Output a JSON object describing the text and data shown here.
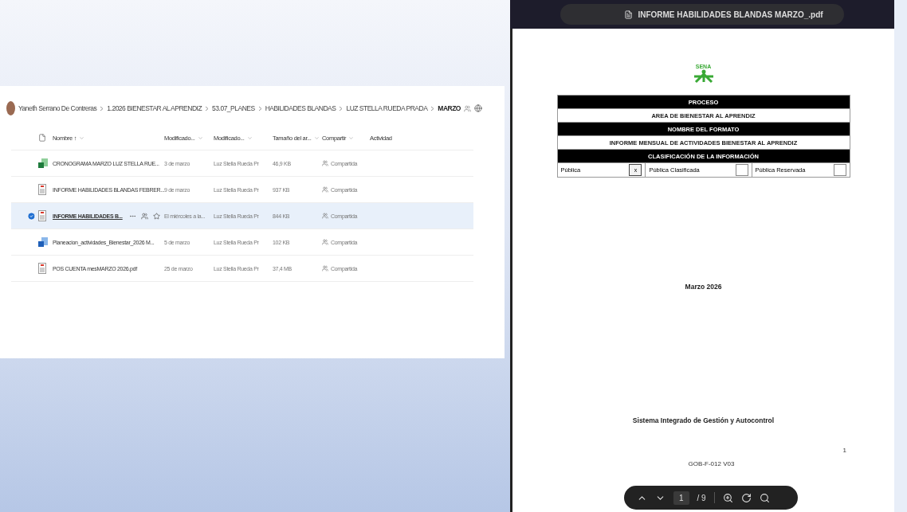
{
  "breadcrumb": {
    "owner": "Yaneth Serrano De Contreras",
    "items": [
      {
        "label": "1.2026 BIENESTAR AL APRENDIZ",
        "current": false
      },
      {
        "label": "53.07_PLANES",
        "current": false
      },
      {
        "label": "HABILIDADES BLANDAS",
        "current": false
      },
      {
        "label": "LUZ STELLA RUEDA PRADA",
        "current": false
      },
      {
        "label": "MARZO",
        "current": true
      }
    ]
  },
  "table": {
    "columns": [
      "Nombre ↑",
      "Modificado...",
      "Modificado...",
      "Tamaño del ar...",
      "Compartir",
      "Actividad"
    ],
    "rows": [
      {
        "kind": "excel",
        "name": "CRONOGRAMA MARZO LUZ STELLA RUE...",
        "modified": "3 de marzo",
        "modified_by": "Luz Stella Rueda Pr",
        "size": "46,9 KB",
        "sharing": "Compartida",
        "selected": false
      },
      {
        "kind": "pdf",
        "name": "INFORME HABILIDADES BLANDAS FEBRER...",
        "modified": "9 de marzo",
        "modified_by": "Luz Stella Rueda Pr",
        "size": "937 KB",
        "sharing": "Compartida",
        "selected": false
      },
      {
        "kind": "pdf",
        "name": "INFORME HABILIDADES B...",
        "modified": "El miércoles a la...",
        "modified_by": "Luz Stella Rueda Pr",
        "size": "844 KB",
        "sharing": "Compartida",
        "selected": true
      },
      {
        "kind": "word",
        "name": "Planeacion_actividades_Bienestar_2026 M...",
        "modified": "5 de marzo",
        "modified_by": "Luz Stella Rueda Pr",
        "size": "102 KB",
        "sharing": "Compartida",
        "selected": false
      },
      {
        "kind": "pdf",
        "name": "POS CUENTA mesMARZO 2026.pdf",
        "modified": "25 de marzo",
        "modified_by": "Luz Stella Rueda Pr",
        "size": "37,4 MB",
        "sharing": "Compartida",
        "selected": false
      }
    ]
  },
  "viewer": {
    "title": "INFORME HABILIDADES BLANDAS MARZO_.pdf",
    "page": {
      "logo_text": "SENA",
      "form_rows": [
        {
          "kind": "header",
          "text": "PROCESO"
        },
        {
          "kind": "value",
          "text": "AREA DE BIENESTAR AL APRENDIZ"
        },
        {
          "kind": "header",
          "text": "NOMBRE DEL FORMATO"
        },
        {
          "kind": "value",
          "text": "INFORME MENSUAL DE ACTIVIDADES BIENESTAR AL APRENDIZ"
        },
        {
          "kind": "header",
          "text": "CLASIFICACIÓN DE LA INFORMACIÓN"
        }
      ],
      "classification": [
        {
          "label": "Pública",
          "mark": "x",
          "checked": true
        },
        {
          "label": "Pública Clasificada",
          "checked": false
        },
        {
          "label": "Pública Reservada",
          "checked": false
        }
      ],
      "date": "Marzo 2026",
      "footer_title": "Sistema Integrado de Gestión y Autocontrol",
      "page_number": "1",
      "code": "GOB-F-012 V03"
    },
    "toolbar": {
      "page_input": "1",
      "page_total": "/ 9"
    }
  }
}
